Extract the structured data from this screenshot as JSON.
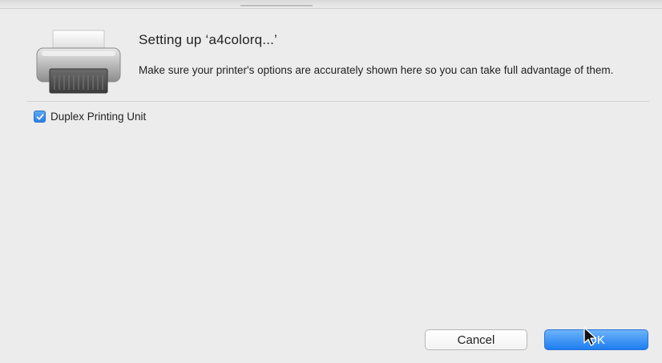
{
  "dialog": {
    "title": "Setting up ‘a4colorq...’",
    "description": "Make sure your printer's options are accurately shown here so you can take full advantage of them.",
    "icon": "printer-icon"
  },
  "options": [
    {
      "label": "Duplex Printing Unit",
      "checked": true
    }
  ],
  "buttons": {
    "cancel_label": "Cancel",
    "ok_label": "OK"
  },
  "colors": {
    "accent": "#2b7ee8",
    "background": "#ececec"
  }
}
